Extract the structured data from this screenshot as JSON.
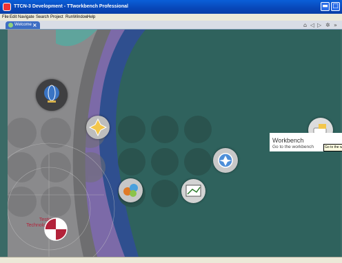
{
  "window": {
    "title": "TTCN-3 Development - TTworkbench Professional"
  },
  "menu": [
    "File",
    "Edit",
    "Navigate",
    "Search",
    "Project",
    "Run",
    "Window",
    "Help"
  ],
  "tab": {
    "label": "Welcome"
  },
  "welcome": {
    "workbench_title": "Workbench",
    "workbench_desc": "Go to the workbench",
    "hover_tooltip": "Go to the wo",
    "logo_text_line1": "Testing",
    "logo_text_line2": "Technologies"
  },
  "colors": {
    "titlebar": "#0847b8",
    "menubar": "#ece9d8",
    "tab": "#3e6ec4",
    "background": "#2f625d",
    "logo_red": "#b3223a"
  }
}
